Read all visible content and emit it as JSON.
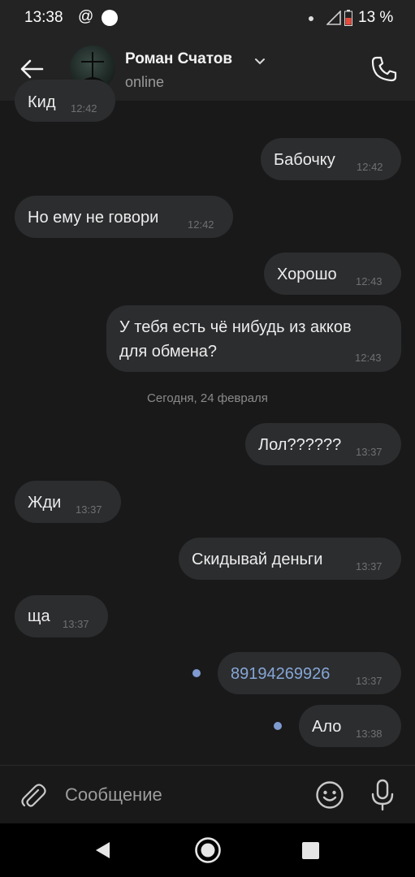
{
  "status_bar": {
    "time": "13:38",
    "at_symbol": "@",
    "battery": "13 %"
  },
  "header": {
    "name": "Роман Счатов",
    "status": "online"
  },
  "messages": [
    {
      "text": "Кид",
      "time": "12:42",
      "side": "in"
    },
    {
      "text": "Бабочку",
      "time": "12:42",
      "side": "out"
    },
    {
      "text": "Но ему не говори",
      "time": "12:42",
      "side": "in"
    },
    {
      "text": "Хорошо",
      "time": "12:43",
      "side": "out"
    },
    {
      "text_line1": "У тебя есть чё нибудь из акков",
      "text_line2": "для обмена?",
      "time": "12:43",
      "side": "out"
    },
    {
      "text": "Лол??????",
      "time": "13:37",
      "side": "out"
    },
    {
      "text": "Жди",
      "time": "13:37",
      "side": "in"
    },
    {
      "text": "Скидывай деньги",
      "time": "13:37",
      "side": "out"
    },
    {
      "text": "ща",
      "time": "13:37",
      "side": "in"
    },
    {
      "text": "89194269926",
      "time": "13:37",
      "side": "out",
      "unread": true,
      "is_link": true
    },
    {
      "text": "Ало",
      "time": "13:38",
      "side": "out",
      "unread": true
    }
  ],
  "date_separator": "Сегодня, 24 февраля",
  "composer": {
    "placeholder": "Сообщение"
  },
  "icons": {
    "back": "arrow-left-icon",
    "call": "phone-icon",
    "attach": "paperclip-icon",
    "emoji": "smiley-icon",
    "mic": "microphone-icon",
    "nav_back": "triangle-back-icon",
    "nav_home": "circle-home-icon",
    "nav_recents": "square-recents-icon"
  },
  "colors": {
    "background": "#19191a",
    "bubble": "#2c2d2f",
    "link": "#85a6d6",
    "unread_dot": "#7f9bd0"
  }
}
